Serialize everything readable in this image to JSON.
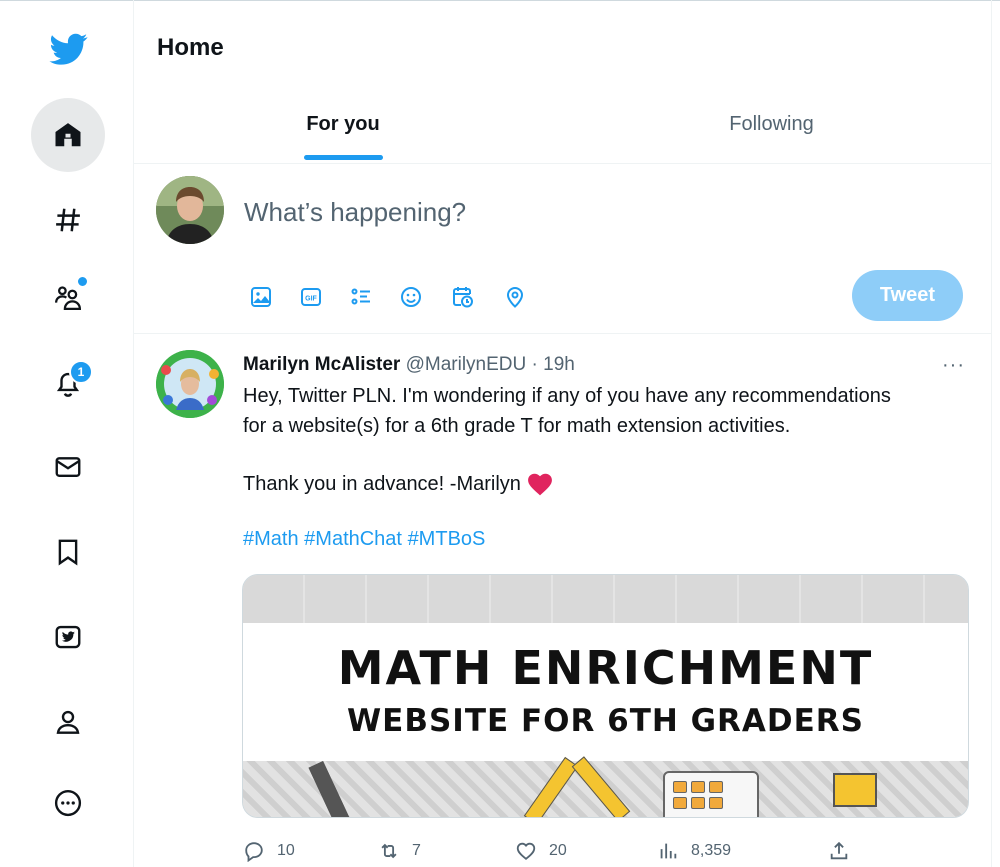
{
  "header": {
    "title": "Home"
  },
  "tabs": [
    {
      "label": "For you",
      "selected": true
    },
    {
      "label": "Following",
      "selected": false
    }
  ],
  "sidebar": {
    "items": [
      {
        "icon": "twitter-logo-icon"
      },
      {
        "icon": "home-icon",
        "active": true
      },
      {
        "icon": "hashtag-icon"
      },
      {
        "icon": "communities-icon",
        "dot": true
      },
      {
        "icon": "bell-icon",
        "badge": "1"
      },
      {
        "icon": "mail-icon"
      },
      {
        "icon": "bookmark-icon"
      },
      {
        "icon": "twitter-blue-icon"
      },
      {
        "icon": "profile-icon"
      },
      {
        "icon": "more-icon"
      }
    ]
  },
  "composer": {
    "placeholder": "What’s happening?",
    "tweet_label": "Tweet",
    "tools": [
      "image-icon",
      "gif-icon",
      "poll-icon",
      "emoji-icon",
      "schedule-icon",
      "location-icon"
    ]
  },
  "tweet": {
    "name": "Marilyn McAlister",
    "handle": "@MarilynEDU",
    "separator": "·",
    "time": "19h",
    "more": "···",
    "text_line1": "Hey, Twitter PLN. I'm wondering if any of you have any recommendations",
    "text_line2": "for a website(s) for a 6th grade T for math extension activities.",
    "text_line3": "Thank you in advance! -Marilyn",
    "hashtags": [
      "#Math",
      "#MathChat",
      "#MTBoS"
    ],
    "media": {
      "title": "MATH ENRICHMENT",
      "subtitle": "WEBSITE FOR 6TH GRADERS"
    },
    "actions": {
      "replies": "10",
      "retweets": "7",
      "likes": "20",
      "views": "8,359"
    }
  },
  "colors": {
    "accent": "#1d9bf0",
    "tweet_button_disabled": "#8ecdf8",
    "muted_text": "#536471",
    "heart": "#e0245e"
  }
}
